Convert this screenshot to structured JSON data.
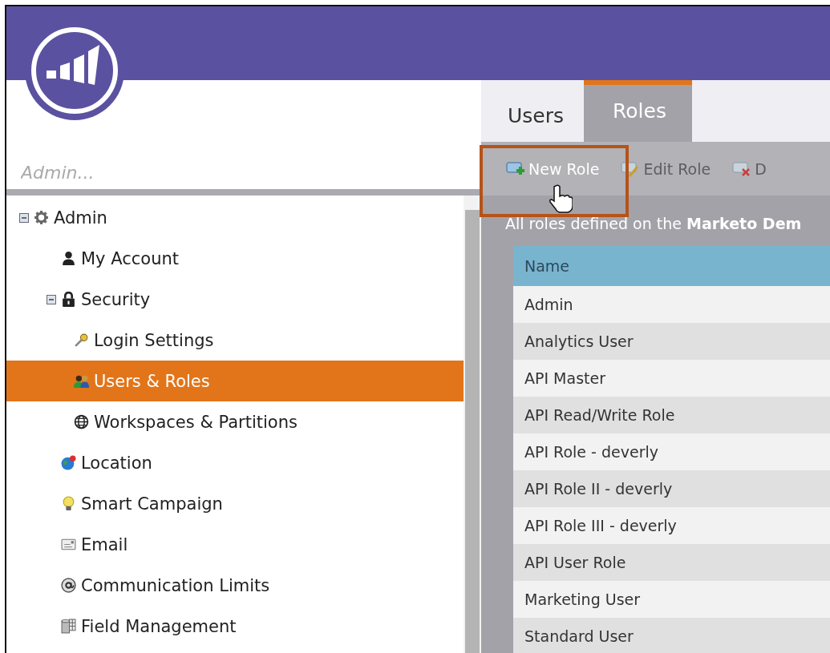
{
  "search": {
    "placeholder": "Admin..."
  },
  "tree": [
    {
      "label": "Admin",
      "expanded": true,
      "selected": false,
      "children": [
        {
          "label": "My Account",
          "selected": false
        },
        {
          "label": "Security",
          "expanded": true,
          "selected": false,
          "children": [
            {
              "label": "Login Settings",
              "selected": false
            },
            {
              "label": "Users & Roles",
              "selected": true
            },
            {
              "label": "Workspaces & Partitions",
              "selected": false
            }
          ]
        },
        {
          "label": "Location",
          "selected": false
        },
        {
          "label": "Smart Campaign",
          "selected": false
        },
        {
          "label": "Email",
          "selected": false
        },
        {
          "label": "Communication Limits",
          "selected": false
        },
        {
          "label": "Field Management",
          "selected": false
        }
      ]
    }
  ],
  "tabs": [
    {
      "label": "Users",
      "selected": false
    },
    {
      "label": "Roles",
      "selected": true
    }
  ],
  "toolbar": [
    {
      "label": "New Role",
      "disabled": false,
      "highlighted": true
    },
    {
      "label": "Edit Role",
      "disabled": true,
      "highlighted": false
    },
    {
      "label": "D",
      "disabled": true,
      "highlighted": false
    }
  ],
  "description": "All roles defined on the **Marketo Dem**",
  "table": {
    "columns": [
      "Name"
    ],
    "rows": [
      "Admin",
      "Analytics User",
      "API Master",
      "API Read/Write Role",
      "API Role - deverly",
      "API Role II - deverly",
      "API Role III - deverly",
      "API User Role",
      "Marketing User",
      "Standard User"
    ]
  }
}
